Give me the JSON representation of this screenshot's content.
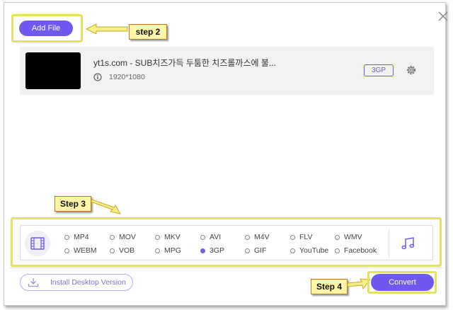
{
  "toolbar": {
    "add_file_label": "Add File"
  },
  "callouts": {
    "step2": "step 2",
    "step3": "Step 3",
    "step4": "Step 4"
  },
  "file": {
    "name": "yt1s.com - SUB치즈가득 두툼한 치즈롤까스에 불...",
    "resolution": "1920*1080",
    "format": "3GP"
  },
  "formats": {
    "row1": [
      "MP4",
      "MOV",
      "MKV",
      "AVI",
      "M4V",
      "FLV",
      "WMV"
    ],
    "row2": [
      "WEBM",
      "VOB",
      "MPG",
      "3GP",
      "GIF",
      "YouTube",
      "Facebook"
    ],
    "selected": "3GP"
  },
  "footer": {
    "install_label": "Install Desktop Version",
    "convert_label": "Convert"
  },
  "colors": {
    "accent": "#6f58ee",
    "highlight": "#e3e35f",
    "callout_bg": "#fff6a8"
  },
  "icons": [
    "close-icon",
    "info-icon",
    "gear-icon",
    "film-icon",
    "music-note-icon",
    "download-icon"
  ]
}
